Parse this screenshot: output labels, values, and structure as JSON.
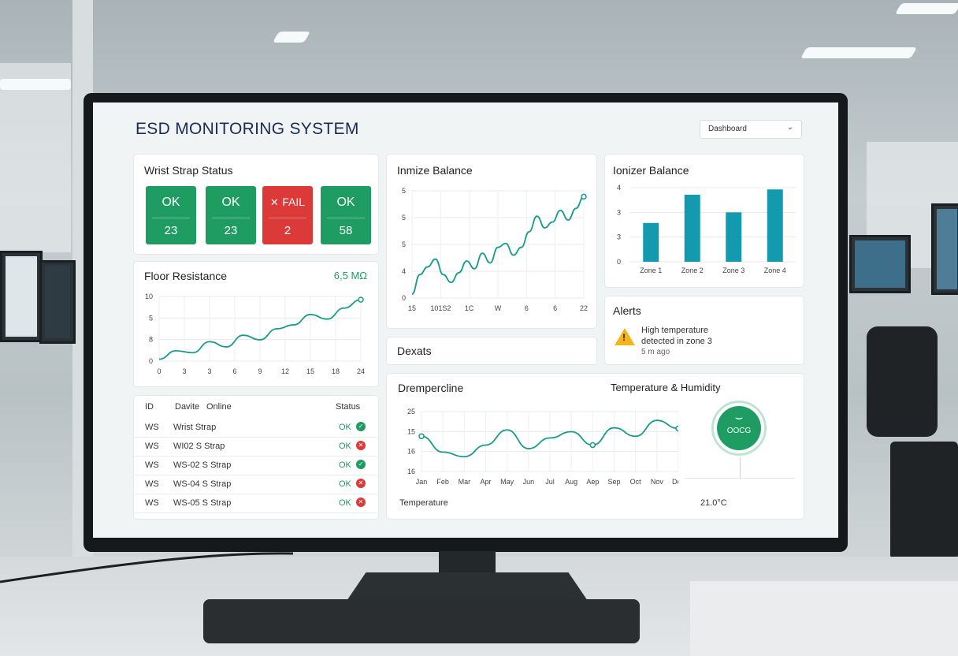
{
  "header": {
    "app_title": "ESD MONITORING SYSTEM",
    "view_select": "Dashboard"
  },
  "wrist_strap": {
    "title": "Wrist Strap Status",
    "tiles": [
      {
        "status": "OK",
        "value": "23",
        "state": "ok"
      },
      {
        "status": "OK",
        "value": "23",
        "state": "ok"
      },
      {
        "status": "FAIL",
        "value": "2",
        "state": "fail"
      },
      {
        "status": "OK",
        "value": "58",
        "state": "ok"
      }
    ]
  },
  "floor_resistance": {
    "title": "Floor Resistance",
    "reading": "6,5 MΩ"
  },
  "ionize_balance": {
    "title": "Inmize Balance"
  },
  "ionizer_balance": {
    "title": "Ionizer Balance"
  },
  "devices_card": {
    "title": "Dexats"
  },
  "alerts": {
    "title": "Alerts",
    "message_line1": "High temperature",
    "message_line2": "detected in zone 3",
    "time": "5 m ago",
    "icon": "warning-icon",
    "icon_glyph": "!"
  },
  "device_table": {
    "headers": {
      "id": "ID",
      "device": "Davite",
      "online": "Online",
      "status": "Status"
    },
    "rows": [
      {
        "id": "WS",
        "name": "Wrist Strap",
        "status": "OK",
        "state": "ok"
      },
      {
        "id": "WS",
        "name": "WI02 S Strap",
        "status": "OK",
        "state": "fail"
      },
      {
        "id": "WS",
        "name": "WS-02 S Strap",
        "status": "OK",
        "state": "ok"
      },
      {
        "id": "WS",
        "name": "WS-04 S Strap",
        "status": "OK",
        "state": "fail"
      },
      {
        "id": "WS",
        "name": "WS-05 S Strap",
        "status": "OK",
        "state": "fail"
      }
    ]
  },
  "temp_humidity": {
    "left_title": "Drempercline",
    "right_title": "Temperature & Humidity",
    "footer_label": "Temperature",
    "gauge_label": "OOCG",
    "gauge_glyph": "⌣",
    "temperature_reading": "21.0°C"
  },
  "icons": {
    "fail_glyph": "✕",
    "ok_glyph": "✓",
    "chevron_glyph": "⌄"
  },
  "colors": {
    "ok_green": "#1e9c62",
    "fail_red": "#dc3a38",
    "chart_teal": "#1a9a8a",
    "bar_teal": "#149aae",
    "warning_yellow": "#f3b51b"
  },
  "chart_data": [
    {
      "id": "floor_resistance",
      "type": "line",
      "x": [
        0,
        2,
        4,
        6,
        8,
        10,
        12,
        14,
        16,
        18,
        20,
        22,
        24
      ],
      "values": [
        0.3,
        1.6,
        1.3,
        3.0,
        2.2,
        4.0,
        3.3,
        5.0,
        5.6,
        7.2,
        6.5,
        8.2,
        9.5
      ],
      "xtick_labels": [
        "0",
        "3",
        "3",
        "6",
        "9",
        "12",
        "15",
        "18",
        "24"
      ],
      "ytick_labels": [
        "10",
        "5",
        "8",
        "0"
      ],
      "ylim": [
        0,
        10
      ],
      "grid": true
    },
    {
      "id": "ionize_balance",
      "type": "line",
      "x": [
        0,
        1,
        2,
        3,
        4,
        5,
        6,
        7,
        8,
        9,
        10,
        11,
        12,
        13,
        14,
        15,
        16,
        17,
        18,
        19,
        20,
        21,
        22
      ],
      "values": [
        0.2,
        1.2,
        1.6,
        2.0,
        1.2,
        0.8,
        1.3,
        1.9,
        1.5,
        2.3,
        1.8,
        2.6,
        2.8,
        2.2,
        2.6,
        3.4,
        4.2,
        3.6,
        3.9,
        4.5,
        4.0,
        4.6,
        5.2
      ],
      "xtick_labels": [
        "15",
        "101S2",
        "1C",
        "W",
        "6",
        "6",
        "22"
      ],
      "ytick_labels": [
        "5",
        "5",
        "5",
        "4",
        "0"
      ],
      "ylim": [
        0,
        5.5
      ],
      "grid": true
    },
    {
      "id": "ionizer_balance",
      "type": "bar",
      "categories": [
        "Zone 1",
        "Zone 2",
        "Zone 3",
        "Zone 4"
      ],
      "values": [
        2.2,
        3.8,
        2.8,
        4.1
      ],
      "ytick_labels": [
        "4",
        "3",
        "3",
        "0"
      ],
      "ylim": [
        0,
        4.2
      ],
      "grid": true
    },
    {
      "id": "temperature",
      "type": "line",
      "categories": [
        "Jan",
        "Feb",
        "Mar",
        "Apr",
        "May",
        "Jun",
        "Jul",
        "Aug",
        "Aep",
        "Sep",
        "Oct",
        "Nov",
        "Dec"
      ],
      "values": [
        20,
        15.5,
        14.2,
        17.5,
        21.8,
        16.5,
        19.5,
        21.3,
        17.5,
        22.4,
        20.0,
        24.5,
        22.2
      ],
      "ytick_labels": [
        "25",
        "15",
        "16",
        "16"
      ],
      "ylim": [
        10,
        27
      ],
      "grid": true
    }
  ]
}
